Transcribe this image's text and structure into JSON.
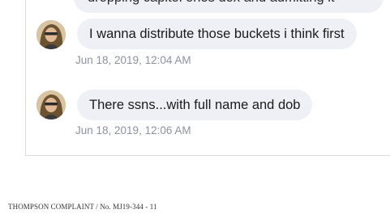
{
  "chat": {
    "partial_message": "dropping capitol ones dox and admitting it",
    "messages": [
      {
        "text": "I wanna distribute those buckets i think first",
        "timestamp": "Jun 18, 2019, 12:04 AM"
      },
      {
        "text": "There ssns...with full name and dob",
        "timestamp": "Jun 18, 2019, 12:06 AM"
      }
    ]
  },
  "footer": {
    "text": "THOMPSON COMPLAINT / No. MJ19-344 - 11"
  }
}
